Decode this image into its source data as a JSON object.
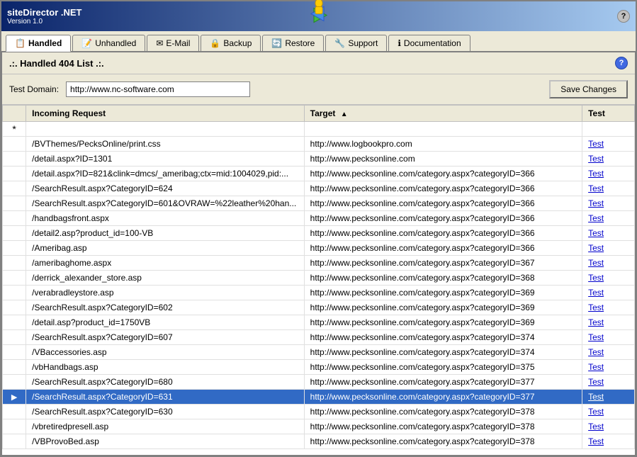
{
  "app": {
    "name": "siteDirector .NET",
    "version": "Version 1.0"
  },
  "tabs": [
    {
      "id": "handled",
      "label": "Handled",
      "active": true,
      "icon": "📋"
    },
    {
      "id": "unhandled",
      "label": "Unhandled",
      "active": false,
      "icon": "📝"
    },
    {
      "id": "email",
      "label": "E-Mail",
      "active": false,
      "icon": "✉"
    },
    {
      "id": "backup",
      "label": "Backup",
      "active": false,
      "icon": "🔒"
    },
    {
      "id": "restore",
      "label": "Restore",
      "active": false,
      "icon": "🔄"
    },
    {
      "id": "support",
      "label": "Support",
      "active": false,
      "icon": "🔧"
    },
    {
      "id": "documentation",
      "label": "Documentation",
      "active": false,
      "icon": "ℹ"
    }
  ],
  "section": {
    "title": ".:. Handled 404 List .:."
  },
  "domain": {
    "label": "Test Domain:",
    "value": "http://www.nc-software.com",
    "placeholder": ""
  },
  "buttons": {
    "save_changes": "Save Changes"
  },
  "table": {
    "columns": [
      {
        "id": "marker",
        "label": ""
      },
      {
        "id": "incoming",
        "label": "Incoming Request"
      },
      {
        "id": "target",
        "label": "Target"
      },
      {
        "id": "test",
        "label": "Test"
      }
    ],
    "rows": [
      {
        "marker": "*",
        "incoming": "",
        "target": "",
        "test": "",
        "star": true
      },
      {
        "marker": "",
        "incoming": "/BVThemes/PecksOnline/print.css",
        "target": "http://www.logbookpro.com",
        "test": "Test",
        "selected": false
      },
      {
        "marker": "",
        "incoming": "/detail.aspx?ID=1301",
        "target": "http://www.pecksonline.com",
        "test": "Test",
        "selected": false
      },
      {
        "marker": "",
        "incoming": "/detail.aspx?ID=821&clink=dmcs/_ameribag;ctx=mid:1004029,pid:...",
        "target": "http://www.pecksonline.com/category.aspx?categoryID=366",
        "test": "Test",
        "selected": false
      },
      {
        "marker": "",
        "incoming": "/SearchResult.aspx?CategoryID=624",
        "target": "http://www.pecksonline.com/category.aspx?categoryID=366",
        "test": "Test",
        "selected": false
      },
      {
        "marker": "",
        "incoming": "/SearchResult.aspx?CategoryID=601&OVRAW=%22leather%20han...",
        "target": "http://www.pecksonline.com/category.aspx?categoryID=366",
        "test": "Test",
        "selected": false
      },
      {
        "marker": "",
        "incoming": "/handbagsfront.aspx",
        "target": "http://www.pecksonline.com/category.aspx?categoryID=366",
        "test": "Test",
        "selected": false
      },
      {
        "marker": "",
        "incoming": "/detail2.asp?product_id=100-VB",
        "target": "http://www.pecksonline.com/category.aspx?categoryID=366",
        "test": "Test",
        "selected": false
      },
      {
        "marker": "",
        "incoming": "/Ameribag.asp",
        "target": "http://www.pecksonline.com/category.aspx?categoryID=366",
        "test": "Test",
        "selected": false
      },
      {
        "marker": "",
        "incoming": "/ameribaghome.aspx",
        "target": "http://www.pecksonline.com/category.aspx?categoryID=367",
        "test": "Test",
        "selected": false
      },
      {
        "marker": "",
        "incoming": "/derrick_alexander_store.asp",
        "target": "http://www.pecksonline.com/category.aspx?categoryID=368",
        "test": "Test",
        "selected": false
      },
      {
        "marker": "",
        "incoming": "/verabradleystore.asp",
        "target": "http://www.pecksonline.com/category.aspx?categoryID=369",
        "test": "Test",
        "selected": false
      },
      {
        "marker": "",
        "incoming": "/SearchResult.aspx?CategoryID=602",
        "target": "http://www.pecksonline.com/category.aspx?categoryID=369",
        "test": "Test",
        "selected": false
      },
      {
        "marker": "",
        "incoming": "/detail.asp?product_id=1750VB",
        "target": "http://www.pecksonline.com/category.aspx?categoryID=369",
        "test": "Test",
        "selected": false
      },
      {
        "marker": "",
        "incoming": "/SearchResult.aspx?CategoryID=607",
        "target": "http://www.pecksonline.com/category.aspx?categoryID=374",
        "test": "Test",
        "selected": false
      },
      {
        "marker": "",
        "incoming": "/VBaccessories.asp",
        "target": "http://www.pecksonline.com/category.aspx?categoryID=374",
        "test": "Test",
        "selected": false
      },
      {
        "marker": "",
        "incoming": "/vbHandbags.asp",
        "target": "http://www.pecksonline.com/category.aspx?categoryID=375",
        "test": "Test",
        "selected": false
      },
      {
        "marker": "",
        "incoming": "/SearchResult.aspx?CategoryID=680",
        "target": "http://www.pecksonline.com/category.aspx?categoryID=377",
        "test": "Test",
        "selected": false
      },
      {
        "marker": "▶",
        "incoming": "/SearchResult.aspx?CategoryID=631",
        "target": "http://www.pecksonline.com/category.aspx?categoryID=377",
        "test": "Test",
        "selected": true
      },
      {
        "marker": "",
        "incoming": "/SearchResult.aspx?CategoryID=630",
        "target": "http://www.pecksonline.com/category.aspx?categoryID=378",
        "test": "Test",
        "selected": false
      },
      {
        "marker": "",
        "incoming": "/vbretiredpresell.asp",
        "target": "http://www.pecksonline.com/category.aspx?categoryID=378",
        "test": "Test",
        "selected": false
      },
      {
        "marker": "",
        "incoming": "/VBProvoBed.asp",
        "target": "http://www.pecksonline.com/category.aspx?categoryID=378",
        "test": "Test",
        "selected": false
      }
    ]
  }
}
